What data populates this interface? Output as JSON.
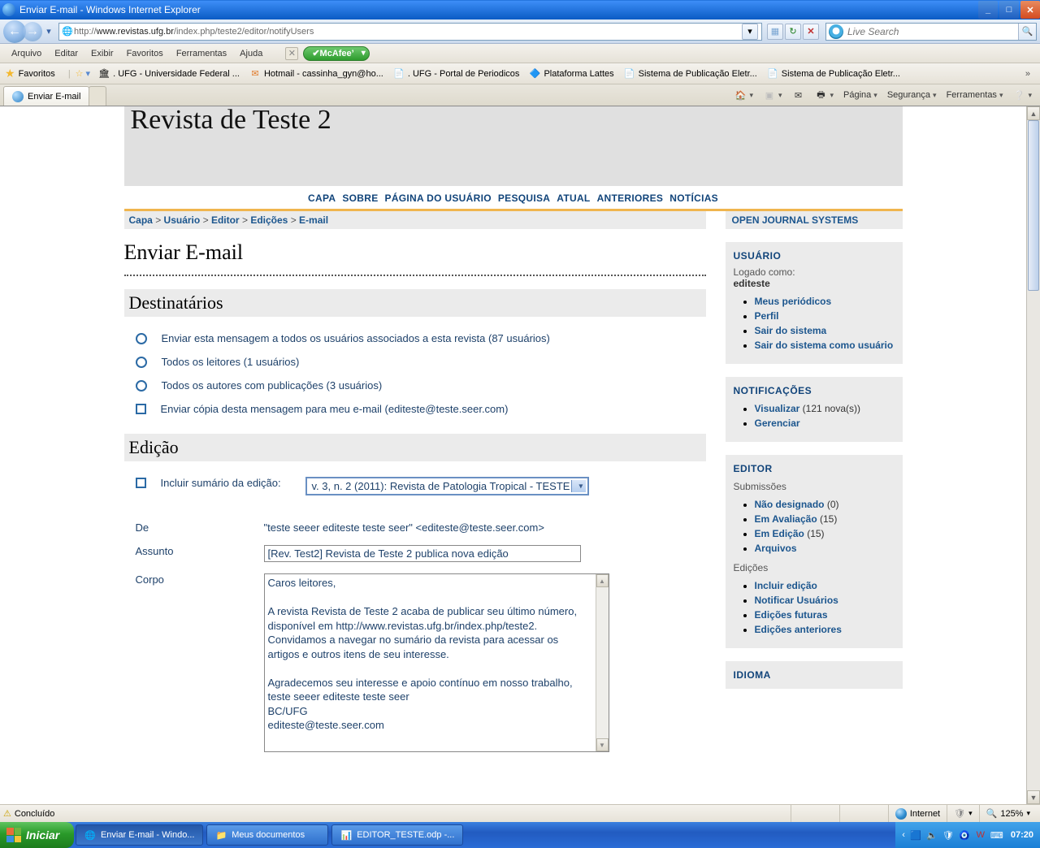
{
  "window": {
    "title": "Enviar E-mail - Windows Internet Explorer"
  },
  "address": {
    "prefix": "http://",
    "host": "www.revistas.ufg.br",
    "path": "/index.php/teste2/editor/notifyUsers"
  },
  "search": {
    "placeholder": "Live Search"
  },
  "menus": [
    "Arquivo",
    "Editar",
    "Exibir",
    "Favoritos",
    "Ferramentas",
    "Ajuda"
  ],
  "mcafee": "McAfee",
  "favbar": {
    "label": "Favoritos",
    "links": [
      {
        "icon": "🏛",
        "text": ". UFG - Universidade Federal ..."
      },
      {
        "icon": "✉",
        "text": "Hotmail - cassinha_gyn@ho..."
      },
      {
        "icon": "📄",
        "text": ". UFG - Portal de Periodicos"
      },
      {
        "icon": "🔷",
        "text": "Plataforma Lattes"
      },
      {
        "icon": "📄",
        "text": "Sistema de Publicação Eletr..."
      },
      {
        "icon": "📄",
        "text": "Sistema de Publicação Eletr..."
      }
    ]
  },
  "tab": {
    "title": "Enviar E-mail"
  },
  "commandbar": {
    "page": "Página",
    "security": "Segurança",
    "tools": "Ferramentas"
  },
  "ojs": {
    "journal": "Revista de Teste 2",
    "nav": [
      "CAPA",
      "SOBRE",
      "PÁGINA DO USUÁRIO",
      "PESQUISA",
      "ATUAL",
      "ANTERIORES",
      "NOTÍCIAS"
    ],
    "breadcrumbs": {
      "items": [
        "Capa",
        "Usuário",
        "Editor",
        "Edições"
      ],
      "current": "E-mail",
      "sep": ">"
    },
    "page_title": "Enviar E-mail",
    "recipients": {
      "heading": "Destinatários",
      "opts": [
        "Enviar esta mensagem a todos os usuários associados a esta revista (87 usuários)",
        "Todos os leitores (1 usuários)",
        "Todos os autores com publicações (3 usuários)"
      ],
      "copy": "Enviar cópia desta mensagem para meu e-mail (editeste@teste.seer.com)"
    },
    "issue": {
      "heading": "Edição",
      "include_label": "Incluir sumário da edição:",
      "select": "v. 3, n. 2 (2011): Revista de Patologia Tropical - TESTE"
    },
    "email": {
      "from_label": "De",
      "from_value": "\"teste seeer editeste teste seer\" <editeste@teste.seer.com>",
      "subject_label": "Assunto",
      "subject_value": "[Rev. Test2] Revista de Teste 2 publica nova edição",
      "body_label": "Corpo",
      "body_value": "Caros leitores,\n\nA revista Revista de Teste 2 acaba de publicar seu último número, disponível em http://www.revistas.ufg.br/index.php/teste2. Convidamos a navegar no sumário da revista para acessar os artigos e outros itens de seu interesse.\n\nAgradecemos seu interesse e apoio contínuo em nosso trabalho,\nteste seeer editeste teste seer\nBC/UFG\nediteste@teste.seer.com"
    },
    "side": {
      "ojs_link": "OPEN JOURNAL SYSTEMS",
      "user": {
        "head": "USUÁRIO",
        "logged": "Logado como:",
        "name": "editeste",
        "links": [
          "Meus periódicos",
          "Perfil",
          "Sair do sistema",
          "Sair do sistema como usuário"
        ]
      },
      "notif": {
        "head": "NOTIFICAÇÕES",
        "view": "Visualizar",
        "view_count": "(121 nova(s))",
        "manage": "Gerenciar"
      },
      "editor": {
        "head": "EDITOR",
        "sub_label": "Submissões",
        "subs": [
          {
            "t": "Não designado",
            "c": "(0)"
          },
          {
            "t": "Em Avaliação",
            "c": "(15)"
          },
          {
            "t": "Em Edição",
            "c": "(15)"
          },
          {
            "t": "Arquivos",
            "c": ""
          }
        ],
        "iss_label": "Edições",
        "issues": [
          "Incluir edição",
          "Notificar Usuários",
          "Edições futuras",
          "Edições anteriores"
        ]
      },
      "lang": {
        "head": "IDIOMA"
      }
    }
  },
  "statusbar": {
    "done": "Concluído",
    "zone": "Internet",
    "zoom": "125%"
  },
  "taskbar": {
    "start": "Iniciar",
    "tasks": [
      {
        "t": "Enviar E-mail - Windo..."
      },
      {
        "t": "Meus documentos"
      },
      {
        "t": "EDITOR_TESTE.odp -..."
      }
    ],
    "clock": "07:20"
  }
}
